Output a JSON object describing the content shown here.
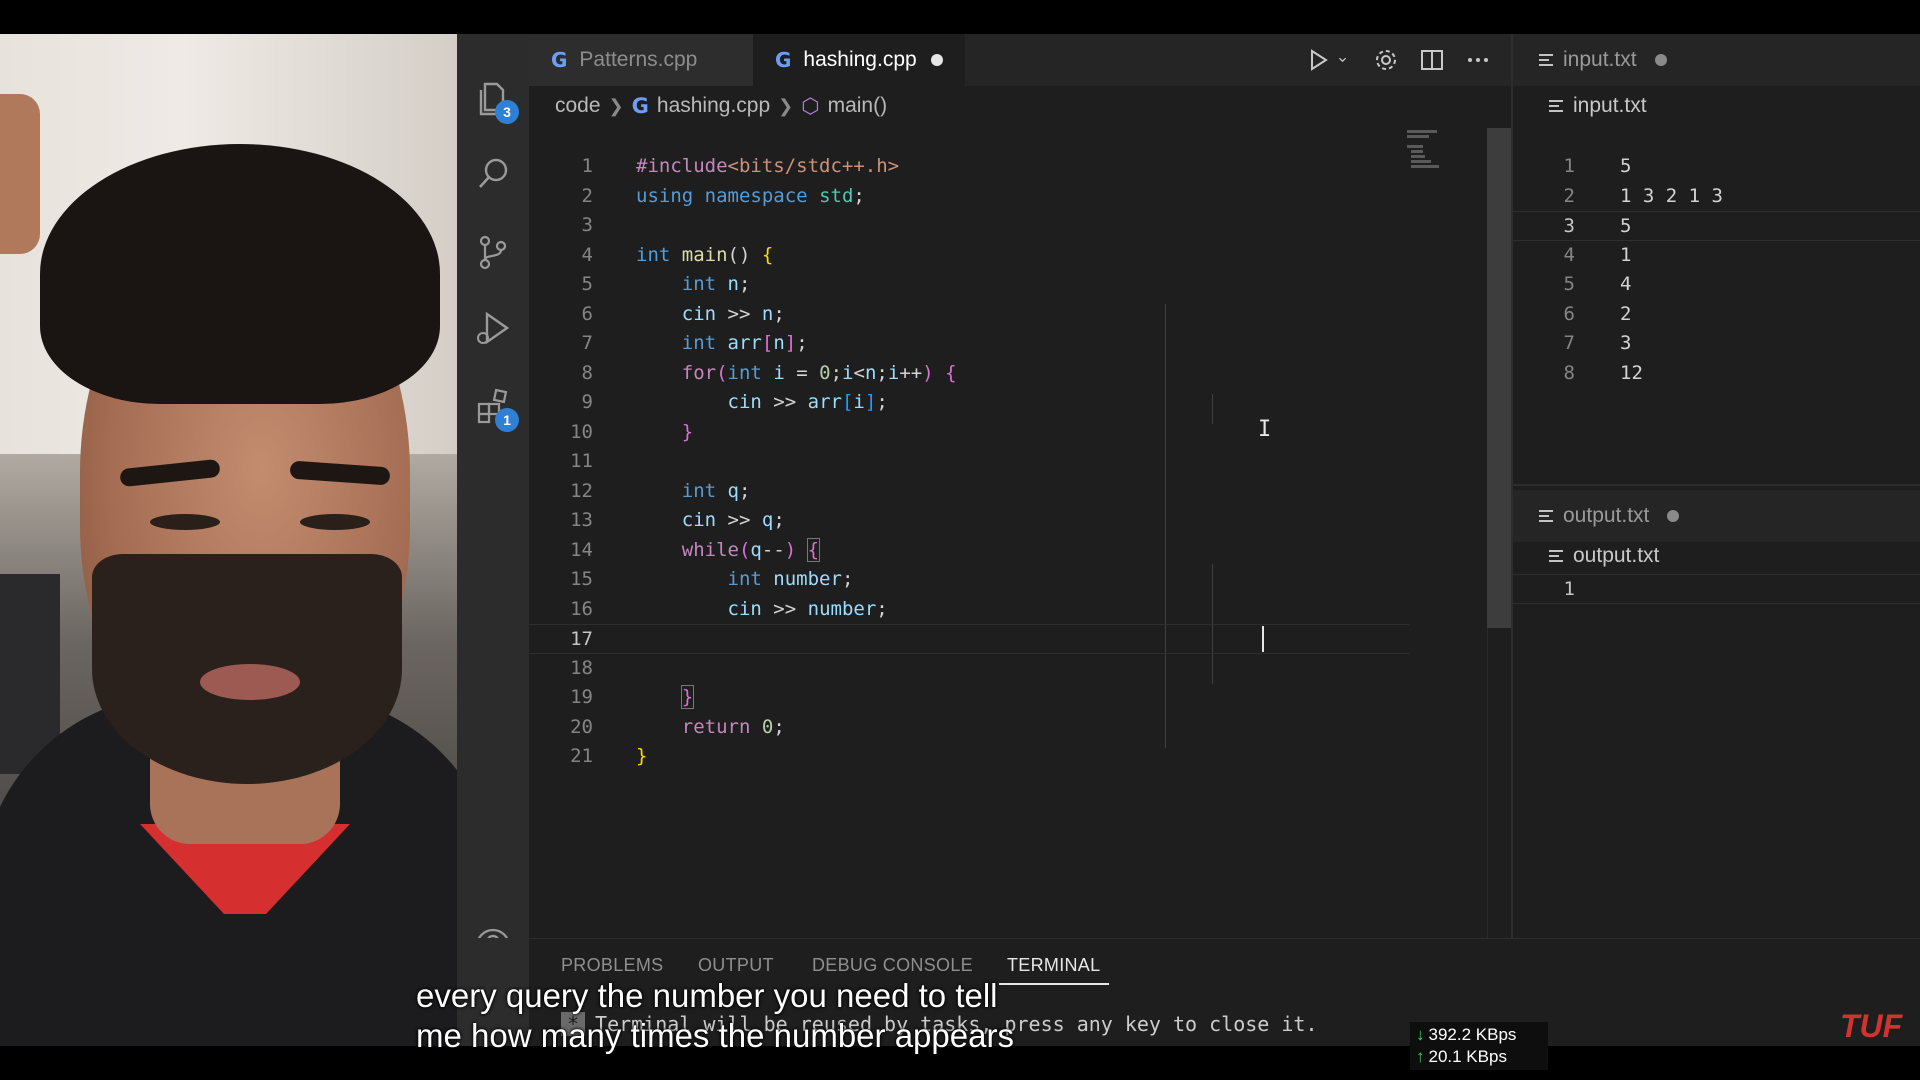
{
  "editor": {
    "tabs": [
      {
        "label": "Patterns.cpp",
        "active": false
      },
      {
        "label": "hashing.cpp",
        "active": true,
        "dirty": true
      }
    ],
    "breadcrumb": [
      "code",
      "hashing.cpp",
      "main()"
    ],
    "lines": [
      {
        "n": "1"
      },
      {
        "n": "2"
      },
      {
        "n": "3"
      },
      {
        "n": "4"
      },
      {
        "n": "5"
      },
      {
        "n": "6"
      },
      {
        "n": "7"
      },
      {
        "n": "8"
      },
      {
        "n": "9"
      },
      {
        "n": "10"
      },
      {
        "n": "11"
      },
      {
        "n": "12"
      },
      {
        "n": "13"
      },
      {
        "n": "14"
      },
      {
        "n": "15"
      },
      {
        "n": "16"
      },
      {
        "n": "17"
      },
      {
        "n": "18"
      },
      {
        "n": "19"
      },
      {
        "n": "20"
      },
      {
        "n": "21"
      }
    ],
    "current_line": "17"
  },
  "activity_bar": {
    "items": [
      {
        "icon": "files-icon",
        "badge": "3"
      },
      {
        "icon": "search-icon"
      },
      {
        "icon": "source-control-icon"
      },
      {
        "icon": "run-debug-icon"
      },
      {
        "icon": "extensions-icon",
        "badge": "1"
      }
    ],
    "account_icon": "account-icon"
  },
  "input_panel": {
    "tab": "input.txt",
    "breadcrumb": "input.txt",
    "lines": [
      {
        "n": "1",
        "text": "5"
      },
      {
        "n": "2",
        "text": "1 3 2 1 3"
      },
      {
        "n": "3",
        "text": "5"
      },
      {
        "n": "4",
        "text": "1"
      },
      {
        "n": "5",
        "text": "4"
      },
      {
        "n": "6",
        "text": "2"
      },
      {
        "n": "7",
        "text": "3"
      },
      {
        "n": "8",
        "text": "12"
      }
    ]
  },
  "output_panel": {
    "tab": "output.txt",
    "breadcrumb": "output.txt",
    "lines": [
      {
        "n": "1",
        "text": ""
      }
    ]
  },
  "bottom_panel": {
    "tabs": [
      "PROBLEMS",
      "OUTPUT",
      "DEBUG CONSOLE",
      "TERMINAL"
    ],
    "active_tab": "TERMINAL",
    "terminal_star": "*",
    "terminal_text": "Terminal will be reused by tasks, press any key to close it."
  },
  "overlay": {
    "subtitle_line1": "every query the number you need to tell",
    "subtitle_line2": "me how many times the number appears",
    "net_down": "392.2 KBps",
    "net_up": "20.1 KBps",
    "watermark": "TUF"
  },
  "colors": {
    "accent": "#2f7fd4",
    "keyword": "#569cd6",
    "control": "#c586c0",
    "watermark": "#d2332e"
  }
}
